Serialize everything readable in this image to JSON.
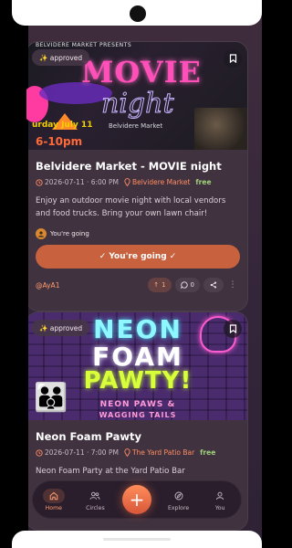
{
  "feed": {
    "cards": [
      {
        "badge": "✨ approved",
        "poster": {
          "top_text": "BELVIDERE MARKET PRESENTS",
          "headline": "MOVIE",
          "subhead": "night",
          "date": "urday July 11",
          "time": "6-10pm",
          "location": "Belvidere Market"
        },
        "title": "Belvidere Market - MOVIE night",
        "datetime": "2026-07-11 · 6:00 PM",
        "location": "Belvidere Market",
        "price": "free",
        "description": "Enjoy an outdoor movie night with local vendors and food trucks. Bring your own lawn chair!",
        "going_label": "You're going",
        "going_button": "✓  You're going ✓",
        "author": "@AyA1",
        "upvotes": "1",
        "comments": "0"
      },
      {
        "badge": "✨ approved",
        "poster": {
          "line1": "NEON",
          "line2": "FOAM",
          "line3": "PAWTY!",
          "line4": "NEON PAWS &",
          "line5": "WAGGING TAILS"
        },
        "title": "Neon Foam Pawty",
        "datetime": "2026-07-11 · 7:00 PM",
        "location": "The Yard Patio Bar",
        "price": "free",
        "description": "Neon Foam Party at the Yard Patio Bar"
      }
    ]
  },
  "nav": {
    "items": [
      {
        "label": "Home",
        "icon": "home-icon"
      },
      {
        "label": "Circles",
        "icon": "people-icon"
      },
      {
        "label": "Explore",
        "icon": "compass-icon"
      },
      {
        "label": "You",
        "icon": "user-icon"
      }
    ],
    "fab": "+"
  },
  "colors": {
    "accent": "#c8613d",
    "background": "#3a2a3a",
    "free": "#9fd07a"
  }
}
